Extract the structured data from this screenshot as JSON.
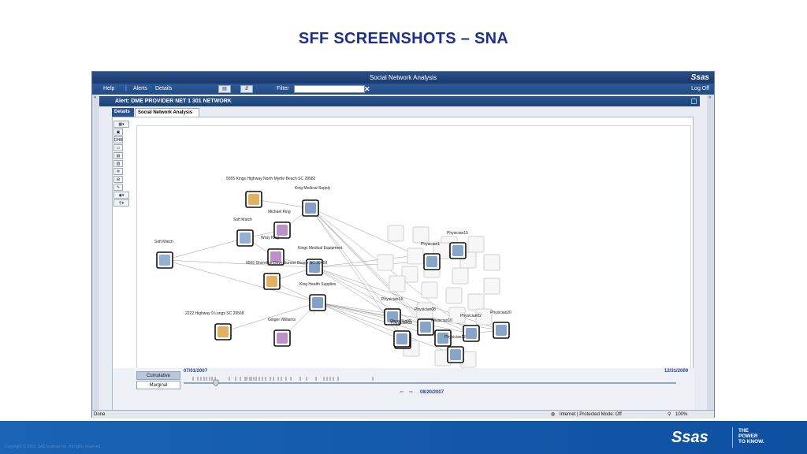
{
  "slide_title": "SFF SCREENSHOTS – SNA",
  "window": {
    "title": "Social Network Analysis",
    "brand": "Ssas"
  },
  "menubar": {
    "help": "Help",
    "alerts": "Alerts",
    "details": "Details",
    "filter_label": "Filter",
    "filter_value": "",
    "clear": "✕",
    "logoff": "Log Off"
  },
  "alert": {
    "label": "Alert:",
    "name": "DME PROVIDER NET 1 301 NETWORK"
  },
  "tabs": [
    "Details",
    "Social Network Analysis"
  ],
  "graph": {
    "nodes": [
      {
        "id": "addr1",
        "label": "5555 Kings Highway North Myrtle Beach SC 29582",
        "type": "address"
      },
      {
        "id": "kms",
        "label": "King Medical Supply",
        "type": "supply"
      },
      {
        "id": "mk",
        "label": "Michael King",
        "type": "person"
      },
      {
        "id": "sm1",
        "label": "Soft Match",
        "type": "match"
      },
      {
        "id": "sm2",
        "label": "Soft Match",
        "type": "match"
      },
      {
        "id": "wk",
        "label": "Wray King",
        "type": "person"
      },
      {
        "id": "kme",
        "label": "Kings Medical Equipment",
        "type": "supply"
      },
      {
        "id": "addr2",
        "label": "6565 Shoreline Drive Sunset Beach NC 28468",
        "type": "address"
      },
      {
        "id": "khs",
        "label": "King Health Supplies",
        "type": "supply"
      },
      {
        "id": "addr3",
        "label": "2222 Highway 9 Longs SC 29568",
        "type": "address"
      },
      {
        "id": "gw",
        "label": "Ginger Williams",
        "type": "person"
      },
      {
        "id": "p15",
        "label": "Physician15",
        "type": "doctor"
      },
      {
        "id": "p1",
        "label": "Physician1",
        "type": "doctor"
      },
      {
        "id": "p14",
        "label": "Physician14",
        "type": "doctor"
      },
      {
        "id": "p8",
        "label": "Physician08",
        "type": "doctor"
      },
      {
        "id": "p9",
        "label": "Physician09",
        "type": "doctor"
      },
      {
        "id": "p10",
        "label": "Physician10",
        "type": "doctor"
      },
      {
        "id": "p2",
        "label": "Physician02",
        "type": "doctor"
      },
      {
        "id": "p20",
        "label": "Physician20",
        "type": "doctor"
      },
      {
        "id": "p12",
        "label": "Physician12",
        "type": "doctor"
      },
      {
        "id": "p5",
        "label": "Physician05",
        "type": "doctor"
      }
    ]
  },
  "timeline": {
    "cumulative": "Cumulative",
    "marginal": "Marginal",
    "start_date": "07/01/2007",
    "end_date": "12/31/2009",
    "current_date": "08/20/2007"
  },
  "status": {
    "done": "Done",
    "zone": "Internet | Protected Mode: Off",
    "zoom": "100%"
  },
  "footer": {
    "copyright": "Copyright © 2010, SAS Institute Inc. All rights reserved.",
    "logo": "Ssas",
    "tagline": [
      "THE",
      "POWER",
      "TO KNOW."
    ]
  },
  "colors": {
    "accent": "#1f2f8f",
    "window_bar": "#234a84",
    "footer": "#1560b0"
  }
}
